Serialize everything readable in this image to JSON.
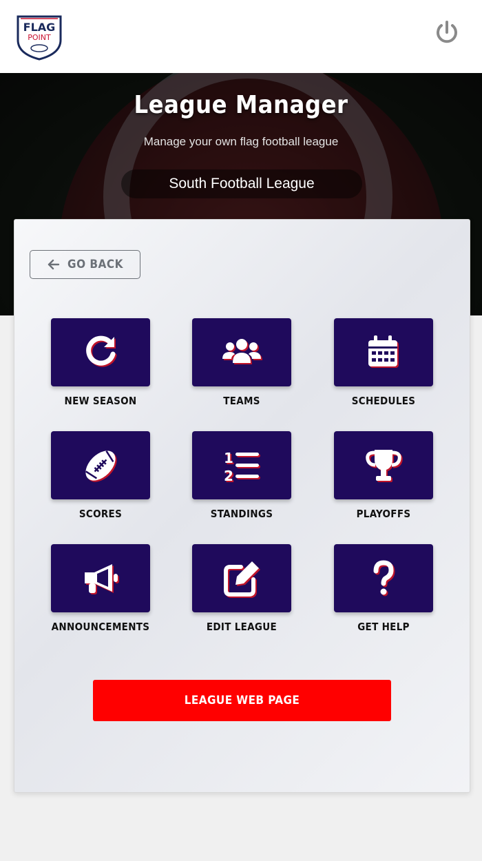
{
  "header": {
    "logo_text_top": "FLAG",
    "logo_text_bottom": "POINT",
    "power_icon": "power-icon"
  },
  "hero": {
    "title": "League Manager",
    "subtitle": "Manage your own flag football league",
    "league_name": "South Football League"
  },
  "nav": {
    "go_back_label": "GO BACK"
  },
  "tiles": [
    {
      "label": "NEW SEASON",
      "icon": "refresh-icon"
    },
    {
      "label": "TEAMS",
      "icon": "users-icon"
    },
    {
      "label": "SCHEDULES",
      "icon": "calendar-icon"
    },
    {
      "label": "SCORES",
      "icon": "football-icon"
    },
    {
      "label": "STANDINGS",
      "icon": "ordered-list-icon"
    },
    {
      "label": "PLAYOFFS",
      "icon": "trophy-icon"
    },
    {
      "label": "ANNOUNCEMENTS",
      "icon": "megaphone-icon"
    },
    {
      "label": "EDIT LEAGUE",
      "icon": "edit-icon"
    },
    {
      "label": "GET HELP",
      "icon": "question-icon"
    }
  ],
  "web_page_button": "LEAGUE WEB PAGE",
  "colors": {
    "tile_bg": "#1f0a5c",
    "accent_red": "#ff0000",
    "icon_shadow": "#c0152a"
  }
}
